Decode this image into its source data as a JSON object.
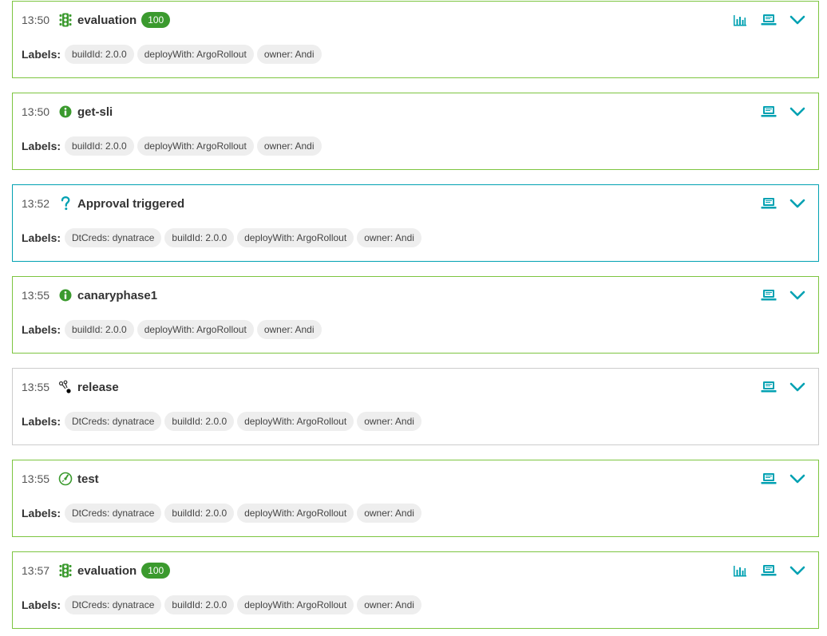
{
  "labels_caption": "Labels:",
  "colors": {
    "success_border": "#7dc540",
    "info_border": "#00a1b2",
    "neutral_border": "#cccccc",
    "icon_green": "#3b9a2e",
    "icon_teal": "#00a1b2",
    "score_badge": "#3b9a2e"
  },
  "events": [
    {
      "time": "13:50",
      "title": "evaluation",
      "icon": "traffic-light-icon",
      "status": "success",
      "score": "100",
      "has_chart": true,
      "labels": [
        "buildId: 2.0.0",
        "deployWith: ArgoRollout",
        "owner: Andi"
      ]
    },
    {
      "time": "13:50",
      "title": "get-sli",
      "icon": "info-icon",
      "status": "success",
      "score": null,
      "has_chart": false,
      "labels": [
        "buildId: 2.0.0",
        "deployWith: ArgoRollout",
        "owner: Andi"
      ]
    },
    {
      "time": "13:52",
      "title": "Approval triggered",
      "icon": "question-icon",
      "status": "info",
      "score": null,
      "has_chart": false,
      "labels": [
        "DtCreds: dynatrace",
        "buildId: 2.0.0",
        "deployWith: ArgoRollout",
        "owner: Andi"
      ]
    },
    {
      "time": "13:55",
      "title": "canaryphase1",
      "icon": "info-icon",
      "status": "success",
      "score": null,
      "has_chart": false,
      "labels": [
        "buildId: 2.0.0",
        "deployWith: ArgoRollout",
        "owner: Andi"
      ]
    },
    {
      "time": "13:55",
      "title": "release",
      "icon": "release-icon",
      "status": "neutral",
      "score": null,
      "has_chart": false,
      "labels": [
        "DtCreds: dynatrace",
        "buildId: 2.0.0",
        "deployWith: ArgoRollout",
        "owner: Andi"
      ]
    },
    {
      "time": "13:55",
      "title": "test",
      "icon": "test-gauge-icon",
      "status": "success",
      "score": null,
      "has_chart": false,
      "labels": [
        "DtCreds: dynatrace",
        "buildId: 2.0.0",
        "deployWith: ArgoRollout",
        "owner: Andi"
      ]
    },
    {
      "time": "13:57",
      "title": "evaluation",
      "icon": "traffic-light-icon",
      "status": "success",
      "score": "100",
      "has_chart": true,
      "labels": [
        "DtCreds: dynatrace",
        "buildId: 2.0.0",
        "deployWith: ArgoRollout",
        "owner: Andi"
      ]
    }
  ]
}
